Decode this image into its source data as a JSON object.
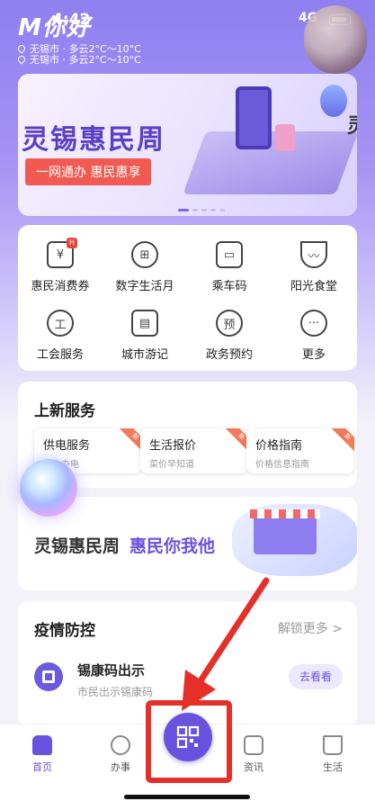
{
  "status_bar": {
    "time": "4:42",
    "network": "4G"
  },
  "header": {
    "brand": "你好",
    "weather_lines": [
      "无锡市 · 多云2°C～10°C",
      "无锡市 · 多云2°C～10°C"
    ]
  },
  "banner": {
    "title": "灵锡惠民周",
    "subtitle": "一网通办 惠民惠享",
    "right_peek": "灵"
  },
  "services_grid": {
    "items": [
      {
        "label": "惠民消费券",
        "icon": "voucher-icon"
      },
      {
        "label": "数字生活月",
        "icon": "gift-icon"
      },
      {
        "label": "乘车码",
        "icon": "bus-icon"
      },
      {
        "label": "阳光食堂",
        "icon": "bowl-icon"
      },
      {
        "label": "工会服务",
        "icon": "union-icon"
      },
      {
        "label": "城市游记",
        "icon": "book-icon"
      },
      {
        "label": "政务预约",
        "icon": "appointment-icon"
      },
      {
        "label": "更多",
        "icon": "more-icon"
      }
    ]
  },
  "new_services": {
    "title": "上新服务",
    "items": [
      {
        "name": "供电服务",
        "desc": "线上办电"
      },
      {
        "name": "生活报价",
        "desc": "菜价早知道"
      },
      {
        "name": "价格指南",
        "desc": "价格信息指南"
      }
    ]
  },
  "promo": {
    "title": "灵锡惠民周",
    "highlight": "惠民你我他"
  },
  "covid": {
    "title": "疫情防控",
    "more": "解锁更多 >",
    "item_name": "锡康码出示",
    "item_desc": "市民出示锡康码",
    "item_button": "去看看"
  },
  "tabbar": {
    "tabs": [
      {
        "label": "首页",
        "active": true
      },
      {
        "label": "办事",
        "active": false
      },
      {
        "label": "资讯",
        "active": false
      },
      {
        "label": "生活",
        "active": false
      }
    ]
  },
  "colors": {
    "accent": "#6a52e0",
    "annotation": "#e5302a"
  }
}
